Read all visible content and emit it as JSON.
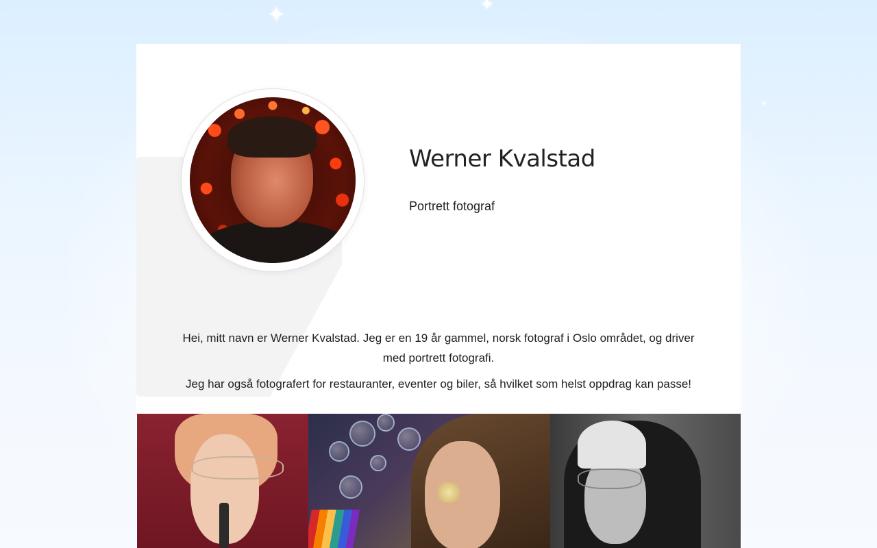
{
  "profile": {
    "name": "Werner Kvalstad",
    "tagline": "Portrett fotograf",
    "avatar_alt": "Portrait of Werner Kvalstad with red bokeh lights"
  },
  "bio": {
    "paragraph_1": "Hei, mitt navn er Werner Kvalstad. Jeg er en 19 år gammel, norsk fotograf i Oslo området, og driver med portrett fotografi.",
    "paragraph_2": "Jeg har også fotografert for restauranter, eventer og biler, så hvilket som helst oppdrag kan passe!"
  },
  "gallery": {
    "photos": [
      {
        "icon": "portrait-photo-lipstick"
      },
      {
        "icon": "portrait-photo-bubbles"
      },
      {
        "icon": "portrait-photo-cap-bw"
      }
    ]
  },
  "colors": {
    "page_background_top": "#dcefff",
    "card_background": "#ffffff",
    "text": "#1a1a1a",
    "accent_bokeh": "#ff4a1a"
  }
}
